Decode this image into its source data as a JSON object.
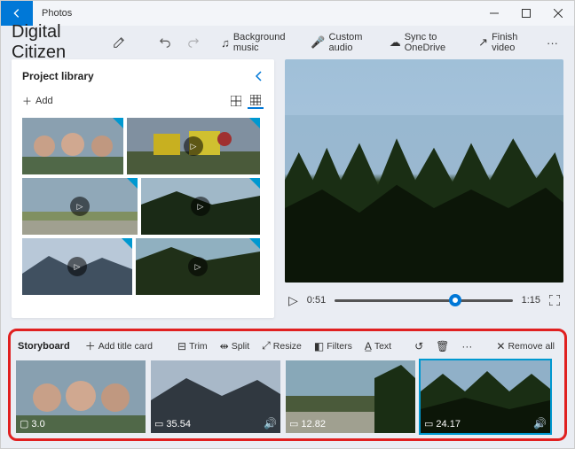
{
  "app": {
    "title": "Photos"
  },
  "project": {
    "name": "Digital Citizen"
  },
  "toolbar": {
    "bgmusic": "Background music",
    "customaudio": "Custom audio",
    "sync": "Sync to OneDrive",
    "finish": "Finish video"
  },
  "library": {
    "title": "Project library",
    "add": "Add"
  },
  "preview": {
    "current": "0:51",
    "total": "1:15"
  },
  "storyboard": {
    "title": "Storyboard",
    "tools": {
      "addtitle": "Add title card",
      "trim": "Trim",
      "split": "Split",
      "resize": "Resize",
      "filters": "Filters",
      "text": "Text",
      "removeall": "Remove all"
    },
    "clips": [
      {
        "duration": "3.0",
        "type": "image",
        "selected": false,
        "hasAudioIcon": false
      },
      {
        "duration": "35.54",
        "type": "video",
        "selected": false,
        "hasAudioIcon": true
      },
      {
        "duration": "12.82",
        "type": "video",
        "selected": false,
        "hasAudioIcon": false
      },
      {
        "duration": "24.17",
        "type": "video",
        "selected": true,
        "hasAudioIcon": true
      }
    ]
  }
}
